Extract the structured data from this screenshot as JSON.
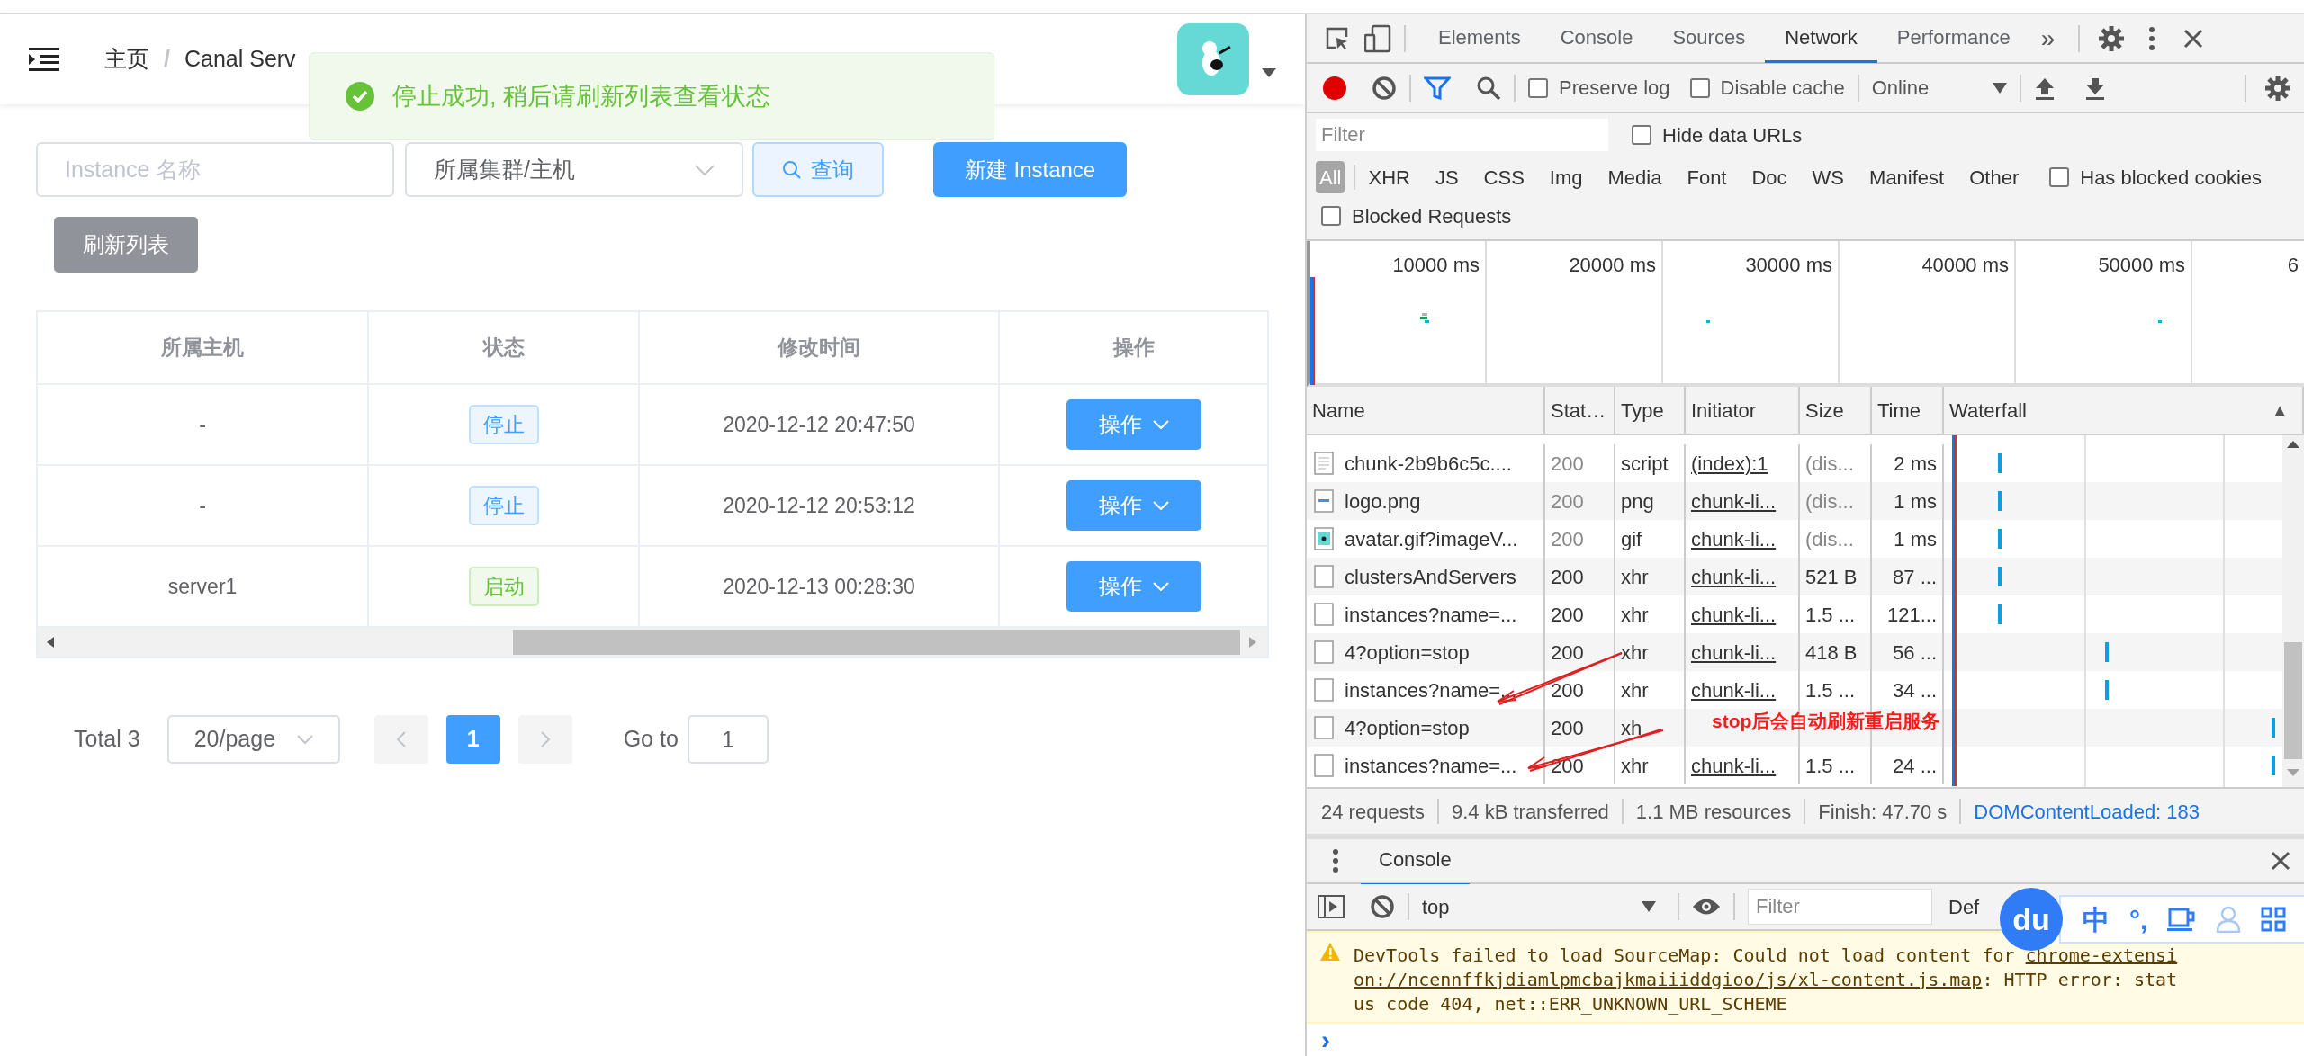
{
  "app": {
    "breadcrumb": [
      {
        "label": "主页"
      },
      {
        "label": "Canal Serv"
      }
    ],
    "breadcrumb_separator": "/",
    "toast": {
      "kind": "success",
      "message": "停止成功, 稍后请刷新列表查看状态"
    },
    "search": {
      "name_placeholder": "Instance 名称",
      "cluster_select": "所属集群/主机",
      "query_button": "查询",
      "new_button": "新建 Instance",
      "refresh_button": "刷新列表"
    },
    "table": {
      "columns": [
        "所属主机",
        "状态",
        "修改时间",
        "操作"
      ],
      "rows": [
        {
          "host": "-",
          "status": "停止",
          "color": "#409eff",
          "modified": "2020-12-12 20:47:50",
          "action": "操作"
        },
        {
          "host": "-",
          "status": "停止",
          "color": "#409eff",
          "modified": "2020-12-12 20:53:12",
          "action": "操作"
        },
        {
          "host": "server1",
          "status": "启动",
          "color": "#67c23a",
          "modified": "2020-12-13 00:28:30",
          "action": "操作"
        }
      ]
    },
    "pagination": {
      "total": "Total 3",
      "page_size": "20/page",
      "pages": [
        {
          "label": "1",
          "selected": true
        }
      ],
      "goto_label": "Go to",
      "goto_value": "1"
    }
  },
  "devtools": {
    "tabs": [
      {
        "label": "Elements",
        "selected": false
      },
      {
        "label": "Console",
        "selected": false
      },
      {
        "label": "Sources",
        "selected": false
      },
      {
        "label": "Network",
        "selected": true
      },
      {
        "label": "Performance",
        "selected": false
      }
    ],
    "more": "»",
    "toolbar": {
      "recording": true,
      "preserve_log": {
        "label": "Preserve log",
        "checked": false
      },
      "disable_cache": {
        "label": "Disable cache",
        "checked": false
      },
      "throttle": "Online"
    },
    "filter": {
      "placeholder": "Filter",
      "hide_data_urls": {
        "label": "Hide data URLs",
        "checked": false
      },
      "types": [
        {
          "label": "All",
          "selected": true
        },
        {
          "label": "XHR",
          "selected": false
        },
        {
          "label": "JS",
          "selected": false
        },
        {
          "label": "CSS",
          "selected": false
        },
        {
          "label": "Img",
          "selected": false
        },
        {
          "label": "Media",
          "selected": false
        },
        {
          "label": "Font",
          "selected": false
        },
        {
          "label": "Doc",
          "selected": false
        },
        {
          "label": "WS",
          "selected": false
        },
        {
          "label": "Manifest",
          "selected": false
        },
        {
          "label": "Other",
          "selected": false
        }
      ],
      "has_blocked_cookies": {
        "label": "Has blocked cookies",
        "checked": false
      },
      "blocked_requests": {
        "label": "Blocked Requests",
        "checked": false
      }
    },
    "overview_ticks": [
      "10000 ms",
      "20000 ms",
      "30000 ms",
      "40000 ms",
      "50000 ms",
      "6"
    ],
    "columns": [
      "Name",
      "Stat…",
      "Type",
      "Initiator",
      "Size",
      "Time",
      "Waterfall"
    ],
    "sort_mark": "▲",
    "requests": [
      {
        "kind": "script",
        "name": "chunk-2b9b6c5c....",
        "status": "200",
        "cached": true,
        "type": "script",
        "initiator": "(index):1",
        "size": "(dis...",
        "time": "2 ms"
      },
      {
        "kind": "image",
        "name": "logo.png",
        "status": "200",
        "cached": true,
        "type": "png",
        "initiator": "chunk-li...",
        "size": "(dis...",
        "time": "1 ms"
      },
      {
        "kind": "avatar",
        "name": "avatar.gif?imageV...",
        "status": "200",
        "cached": true,
        "type": "gif",
        "initiator": "chunk-li...",
        "size": "(dis...",
        "time": "1 ms"
      },
      {
        "kind": "doc",
        "name": "clustersAndServers",
        "status": "200",
        "cached": false,
        "type": "xhr",
        "initiator": "chunk-li...",
        "size": "521 B",
        "time": "87 ..."
      },
      {
        "kind": "doc",
        "name": "instances?name=...",
        "status": "200",
        "cached": false,
        "type": "xhr",
        "initiator": "chunk-li...",
        "size": "1.5 ...",
        "time": "121..."
      },
      {
        "kind": "doc",
        "name": "4?option=stop",
        "status": "200",
        "cached": false,
        "type": "xhr",
        "initiator": "chunk-li...",
        "size": "418 B",
        "time": "56 ..."
      },
      {
        "kind": "doc",
        "name": "instances?name=...",
        "status": "200",
        "cached": false,
        "type": "xhr",
        "initiator": "chunk-li...",
        "size": "1.5 ...",
        "time": "34 ..."
      },
      {
        "kind": "doc",
        "name": "4?option=stop",
        "status": "200",
        "cached": false,
        "type": "xh"
      },
      {
        "kind": "doc",
        "name": "instances?name=...",
        "status": "200",
        "cached": false,
        "type": "xhr",
        "initiator": "chunk-li...",
        "size": "1.5 ...",
        "time": "24 ..."
      }
    ],
    "annotation": {
      "text": "stop后会自动刷新重启服务"
    },
    "summary": [
      "24 requests",
      "9.4 kB transferred",
      "1.1 MB resources",
      "Finish: 47.70 s",
      "DOMContentLoaded: 183"
    ],
    "console": {
      "tab": "Console",
      "context": "top",
      "filter_placeholder": "Filter",
      "levels": "Def",
      "message": {
        "kind": "warning",
        "before": "DevTools failed to load SourceMap: Could not load content for ",
        "link": "chrome-extension://ncennffkjdiamlpmcbajkmaiiiddgioo/js/xl-content.js.map",
        "after": ": HTTP error: status code 404, net::ERR_UNKNOWN_URL_SCHEME"
      },
      "prompt": "›"
    },
    "ime_toolbar": {
      "logo": "du",
      "mode": "中",
      "punctuation": "°,"
    }
  }
}
